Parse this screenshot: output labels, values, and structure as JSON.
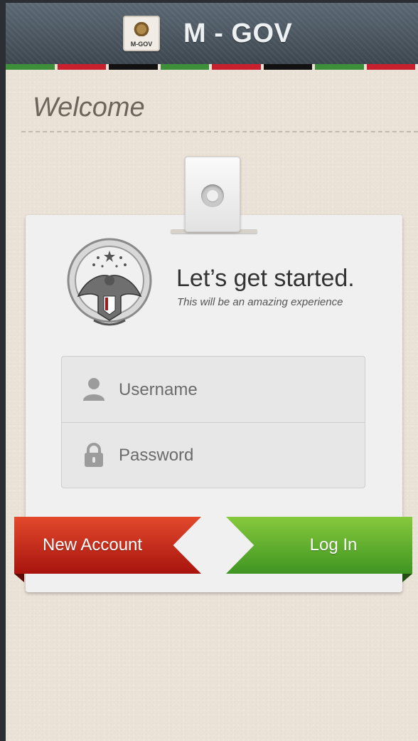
{
  "header": {
    "logo_label": "M-GOV",
    "title": "M - GOV",
    "flag_colors": [
      "#3e8f3a",
      "#c8202e",
      "#111111",
      "#3e8f3a",
      "#c8202e",
      "#111111",
      "#3e8f3a",
      "#c8202e"
    ]
  },
  "welcome": {
    "heading": "Welcome"
  },
  "card": {
    "headline": "Let’s get started.",
    "tagline": "This will be an amazing experience"
  },
  "form": {
    "username_placeholder": "Username",
    "username_value": "",
    "password_placeholder": "Password",
    "password_value": ""
  },
  "actions": {
    "new_account_label": "New Account",
    "login_label": "Log In"
  },
  "icons": {
    "user": "user-icon",
    "lock": "lock-icon",
    "crest": "falcon-emblem",
    "clip_hole": "clip-eyelet-icon"
  }
}
